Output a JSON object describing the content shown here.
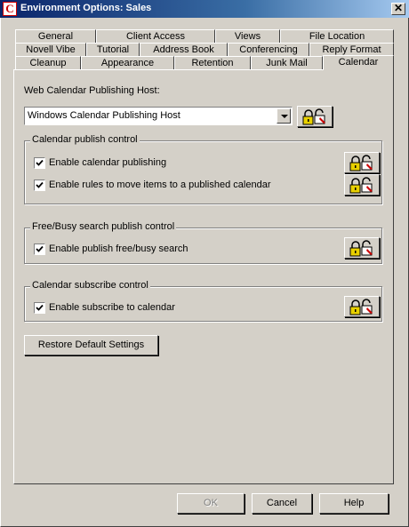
{
  "window": {
    "app_icon_letter": "C",
    "title": "Environment Options: Sales",
    "close_glyph": "✕"
  },
  "tabs": {
    "row1": [
      "General",
      "Client Access",
      "Views",
      "File Location"
    ],
    "row2": [
      "Novell Vibe",
      "Tutorial",
      "Address Book",
      "Conferencing",
      "Reply Format"
    ],
    "row3": [
      "Cleanup",
      "Appearance",
      "Retention",
      "Junk Mail",
      "Calendar"
    ],
    "active": "Calendar"
  },
  "publishing_host": {
    "label": "Web Calendar Publishing Host:",
    "value": "Windows Calendar Publishing Host"
  },
  "groups": {
    "publish": {
      "title": "Calendar publish control",
      "options": [
        {
          "label": "Enable calendar publishing",
          "checked": true
        },
        {
          "label": "Enable rules to move items to a published calendar",
          "checked": true
        }
      ]
    },
    "freebusy": {
      "title": "Free/Busy search publish control",
      "options": [
        {
          "label": "Enable publish free/busy search",
          "checked": true
        }
      ]
    },
    "subscribe": {
      "title": "Calendar subscribe control",
      "options": [
        {
          "label": "Enable subscribe to calendar",
          "checked": true
        }
      ]
    }
  },
  "restore_button": "Restore Default Settings",
  "footer": {
    "ok": "OK",
    "cancel": "Cancel",
    "help": "Help"
  },
  "icons": {
    "lock": "lock-icon",
    "check": "check-icon"
  }
}
